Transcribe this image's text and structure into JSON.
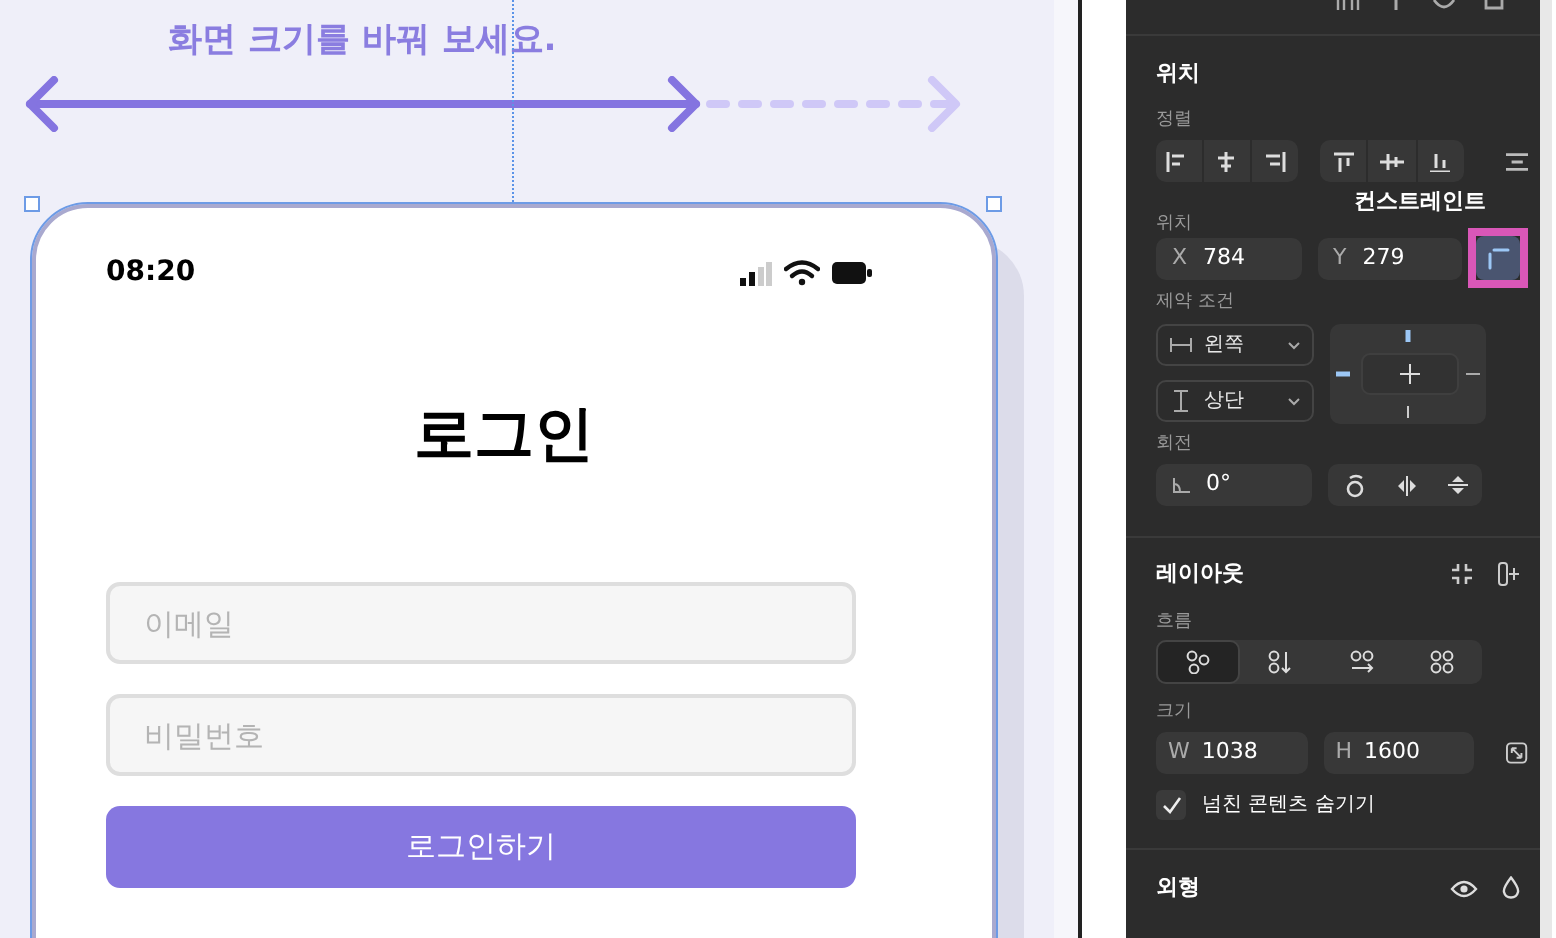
{
  "canvas": {
    "hint": "화면 크기를 바꿔 보세요.",
    "phone": {
      "time": "08:20",
      "title": "로그인",
      "fields": [
        {
          "placeholder": "이메일"
        },
        {
          "placeholder": "비밀번호"
        }
      ],
      "button": "로그인하기"
    }
  },
  "panel": {
    "position": {
      "title": "위치",
      "align_label": "정렬",
      "position_label": "위치",
      "x": {
        "label": "X",
        "value": "784"
      },
      "y": {
        "label": "Y",
        "value": "279"
      },
      "tooltip": "컨스트레인트",
      "constraints_label": "제약 조건",
      "horizontal": "왼쪽",
      "vertical": "상단",
      "rotation_label": "회전",
      "rotation": "0°"
    },
    "layout": {
      "title": "레이아웃",
      "flow_label": "흐름",
      "flow_options": [
        {
          "kind": "free",
          "selected": true
        },
        {
          "kind": "vertical",
          "selected": false
        },
        {
          "kind": "horizontal",
          "selected": false
        },
        {
          "kind": "grid",
          "selected": false
        }
      ],
      "size_label": "크기",
      "w": {
        "label": "W",
        "value": "1038"
      },
      "h": {
        "label": "H",
        "value": "1600"
      },
      "clip": {
        "label": "넘친 콘텐츠 숨기기",
        "checked": true
      }
    },
    "appearance": {
      "title": "외형"
    }
  }
}
